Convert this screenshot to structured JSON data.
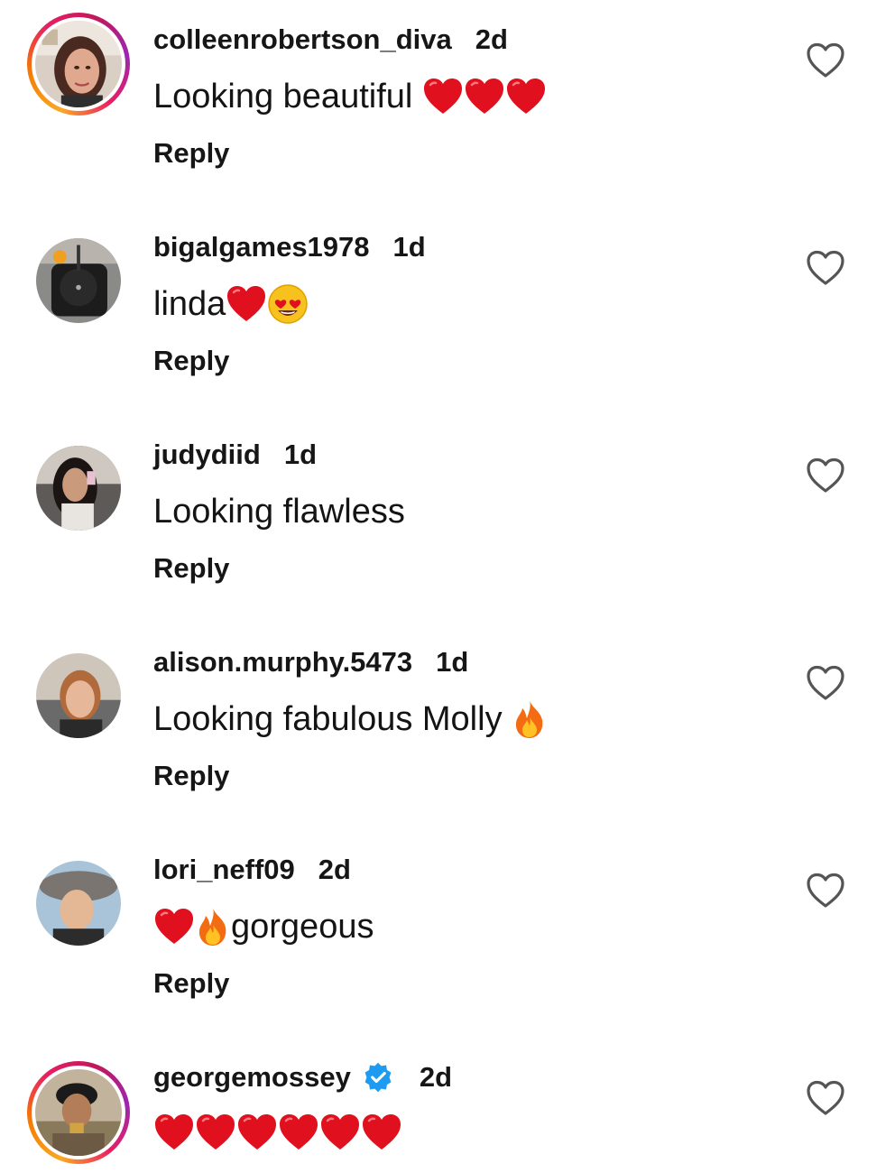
{
  "reply_label": "Reply",
  "icons": {
    "like": "heart-outline-icon",
    "verified": "verified-badge-icon",
    "red_heart": "red-heart-emoji",
    "heart_eyes": "smiling-face-with-heart-eyes-emoji",
    "fire": "fire-emoji"
  },
  "colors": {
    "red_heart": "#e0101e",
    "verified": "#1d9bf0",
    "story_ring_start": "#f9a825",
    "story_ring_end": "#c2185b",
    "text": "#111111"
  },
  "comments": [
    {
      "username": "colleenrobertson_diva",
      "time": "2d",
      "text": "Looking beautiful ",
      "emoji_after": [
        "red_heart",
        "red_heart",
        "red_heart"
      ],
      "story_ring": true
    },
    {
      "username": "bigalgames1978",
      "time": "1d",
      "text": "linda",
      "emoji_after": [
        "red_heart",
        "heart_eyes"
      ],
      "story_ring": false
    },
    {
      "username": "judydiid",
      "time": "1d",
      "text": "Looking flawless",
      "emoji_after": [],
      "story_ring": false
    },
    {
      "username": "alison.murphy.5473",
      "time": "1d",
      "text": "Looking fabulous Molly ",
      "emoji_after": [
        "fire"
      ],
      "story_ring": false
    },
    {
      "username": "lori_neff09",
      "time": "2d",
      "text": "gorgeous",
      "emoji_before": [
        "red_heart",
        "fire"
      ],
      "story_ring": false
    },
    {
      "username": "georgemossey",
      "time": "2d",
      "verified": true,
      "text": "",
      "emoji_after": [
        "red_heart",
        "red_heart",
        "red_heart",
        "red_heart",
        "red_heart",
        "red_heart"
      ],
      "story_ring": true
    }
  ]
}
